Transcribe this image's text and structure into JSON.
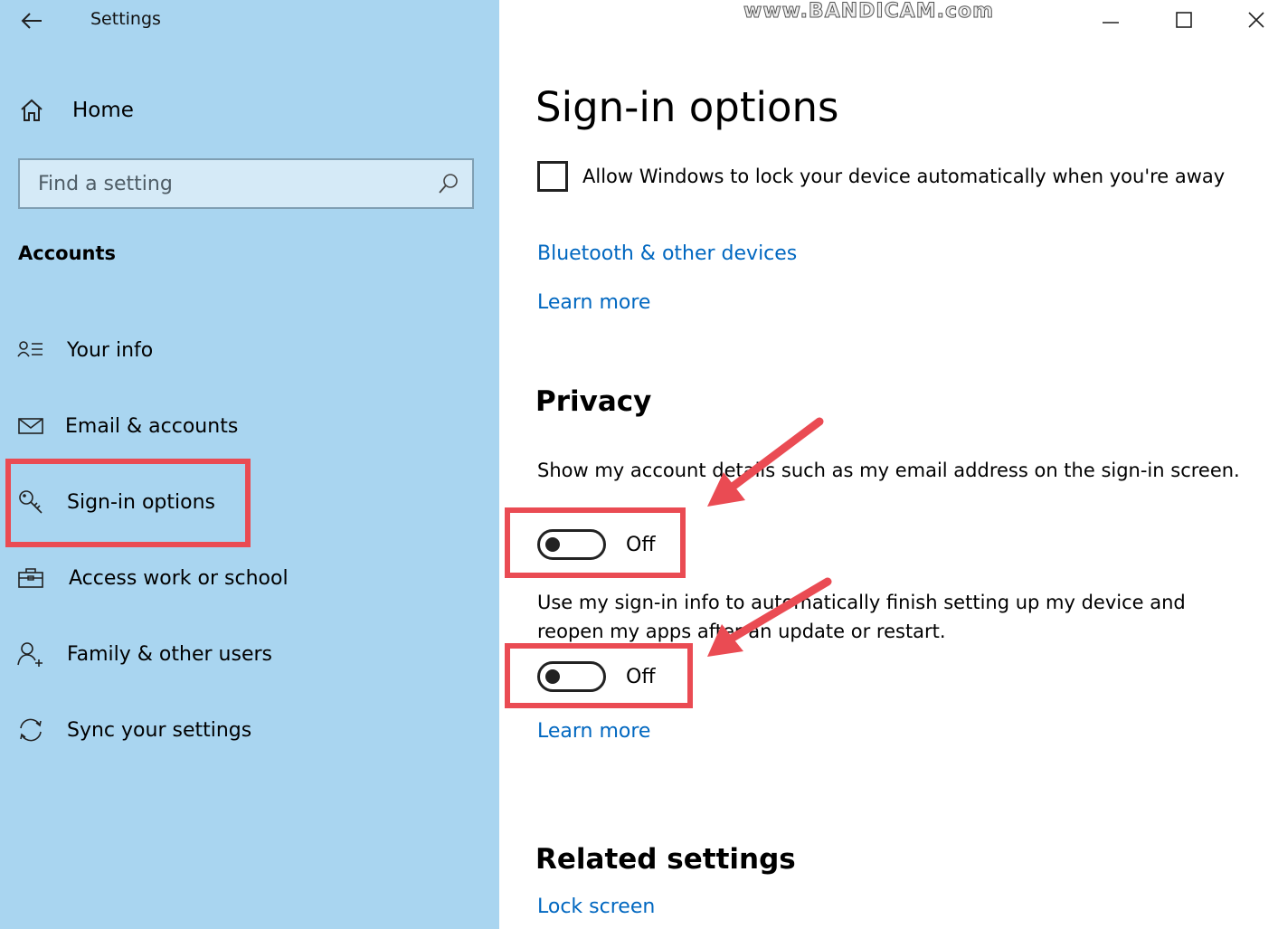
{
  "window": {
    "title": "Settings",
    "watermark": "www.BANDICAM.com"
  },
  "sidebar": {
    "home_label": "Home",
    "search": {
      "placeholder": "Find a setting",
      "value": ""
    },
    "section": "Accounts",
    "items": [
      {
        "label": "Your info",
        "icon": "person-list-icon"
      },
      {
        "label": "Email & accounts",
        "icon": "envelope-icon"
      },
      {
        "label": "Sign-in options",
        "icon": "key-icon",
        "selected": true
      },
      {
        "label": "Access work or school",
        "icon": "briefcase-icon"
      },
      {
        "label": "Family & other users",
        "icon": "person-add-icon"
      },
      {
        "label": "Sync your settings",
        "icon": "sync-icon"
      }
    ]
  },
  "main": {
    "title": "Sign-in options",
    "dynamic_lock": {
      "label": "Allow Windows to lock your device automatically when you're away",
      "checked": false
    },
    "bluetooth_link": "Bluetooth & other devices",
    "learn_more_1": "Learn more",
    "privacy": {
      "heading": "Privacy",
      "setting1": {
        "description": "Show my account details such as my email address on the sign-in screen.",
        "state": "Off"
      },
      "setting2": {
        "description": "Use my sign-in info to automatically finish setting up my device and reopen my apps after an update or restart.",
        "state": "Off"
      },
      "learn_more": "Learn more"
    },
    "related": {
      "heading": "Related settings",
      "lock_screen_link": "Lock screen"
    }
  },
  "colors": {
    "sidebar_bg": "#a9d5f0",
    "link": "#0067c0",
    "annotation": "#ea4b53"
  }
}
